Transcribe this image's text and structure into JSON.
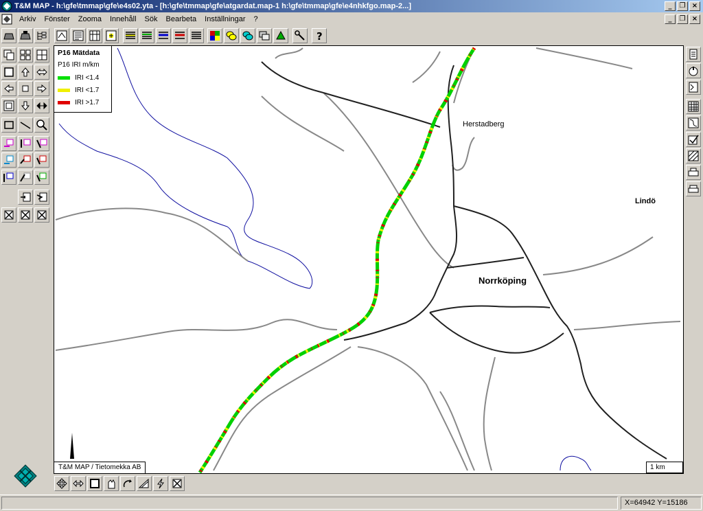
{
  "window": {
    "title": "T&M MAP - h:\\gfe\\tmmap\\gfe\\e4s02.yta - [h:\\gfe\\tmmap\\gfe\\atgardat.map-1 h:\\gfe\\tmmap\\gfe\\e4nhkfgo.map-2...]",
    "minimize": "_",
    "restore": "❐",
    "close": "×"
  },
  "menu": {
    "items": [
      "Arkiv",
      "Fönster",
      "Zooma",
      "Innehåll",
      "Sök",
      "Bearbeta",
      "Inställningar",
      "?"
    ]
  },
  "legend": {
    "title": "P16 Mätdata",
    "subtitle": "P16 IRI m/km",
    "entries": [
      {
        "label": "IRI <1.4",
        "color": "#00e000"
      },
      {
        "label": "IRI <1.7",
        "color": "#f0f000"
      },
      {
        "label": "IRI >1.7",
        "color": "#e00000"
      }
    ]
  },
  "map": {
    "places": [
      "Herstadberg",
      "Lindö",
      "Norrköping"
    ],
    "copyright": "T&M MAP / Tietomekka AB",
    "scale": "1 km"
  },
  "status": {
    "coords": "X=64942  Y=15186"
  },
  "icons": {
    "top_toolbar": [
      "map-layers-icon",
      "map-info-icon",
      "table-icon",
      "grid-icon",
      "text-frame-icon",
      "list-lines-icon",
      "list-green-icon",
      "list-blue-icon",
      "list-red-icon",
      "list-gray-icon",
      "color-palette-icon",
      "yellow-shapes-icon",
      "cyan-shapes-icon",
      "gray-shapes-icon",
      "green-arrow-icon",
      "tools-icon",
      "help-icon"
    ],
    "left_toolbar": [
      "open-map-icon",
      "save-map-icon",
      "tree-icon",
      "layers-icon",
      "tile-icon",
      "split-icon",
      "zoom-window-icon",
      "pan-up-icon",
      "pan-lr-icon",
      "pan-left-icon",
      "center-icon",
      "pan-right-icon",
      "zoom-out-box-icon",
      "pan-down-icon",
      "fit-icon",
      "select-box-icon",
      "measure-line-icon",
      "zoom-lens-icon"
    ],
    "right_toolbar": [
      "scroll-up-icon",
      "stamp-icon",
      "document-icon",
      "grid-view-icon",
      "route-icon",
      "check-icon",
      "hatch-icon",
      "printer-icon",
      "printer2-icon"
    ],
    "bottom_toolbar": [
      "move-icon",
      "width-icon",
      "square-icon",
      "hand-icon",
      "rotate-icon",
      "triangle-icon",
      "lightning-icon",
      "delete-icon"
    ]
  }
}
